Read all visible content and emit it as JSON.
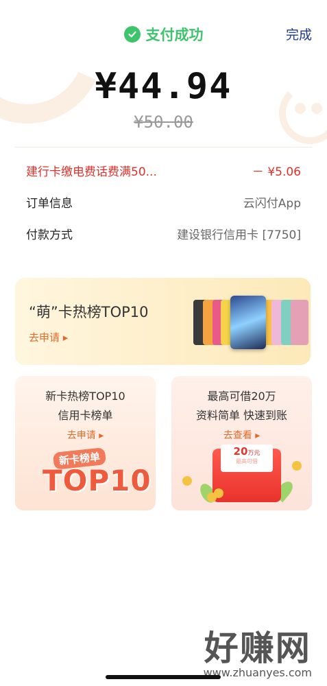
{
  "header": {
    "status_text": "支付成功",
    "done_label": "完成"
  },
  "payment": {
    "amount": "¥44.94",
    "original_amount": "¥50.00"
  },
  "info": [
    {
      "key": "建行卡缴电费话费满50...",
      "value": "－ ¥5.06",
      "highlight": true
    },
    {
      "key": "订单信息",
      "value": "云闪付App"
    },
    {
      "key": "付款方式",
      "value": "建设银行信用卡 [7750]"
    }
  ],
  "banner_big": {
    "title": "“萌”卡热榜TOP10",
    "cta": "去申请 ▸"
  },
  "banner_left": {
    "line1": "新卡热榜TOP10",
    "line2": "信用卡榜单",
    "cta": "去申请 ▸",
    "badge": "新卡榜单",
    "art_text": "TOP10"
  },
  "banner_right": {
    "line1": "最高可借20万",
    "line2": "资料简单  快速到账",
    "cta": "去查看 ▸",
    "envelope_amount": "20",
    "envelope_unit": "万元",
    "envelope_note": "最高可借"
  },
  "watermark": {
    "big": "好赚网",
    "url": "www.zhuanyes.com"
  },
  "colors": {
    "success": "#3ec46d",
    "promo": "#e0302a",
    "accent": "#e06b2b",
    "link": "#1e3a8a"
  }
}
